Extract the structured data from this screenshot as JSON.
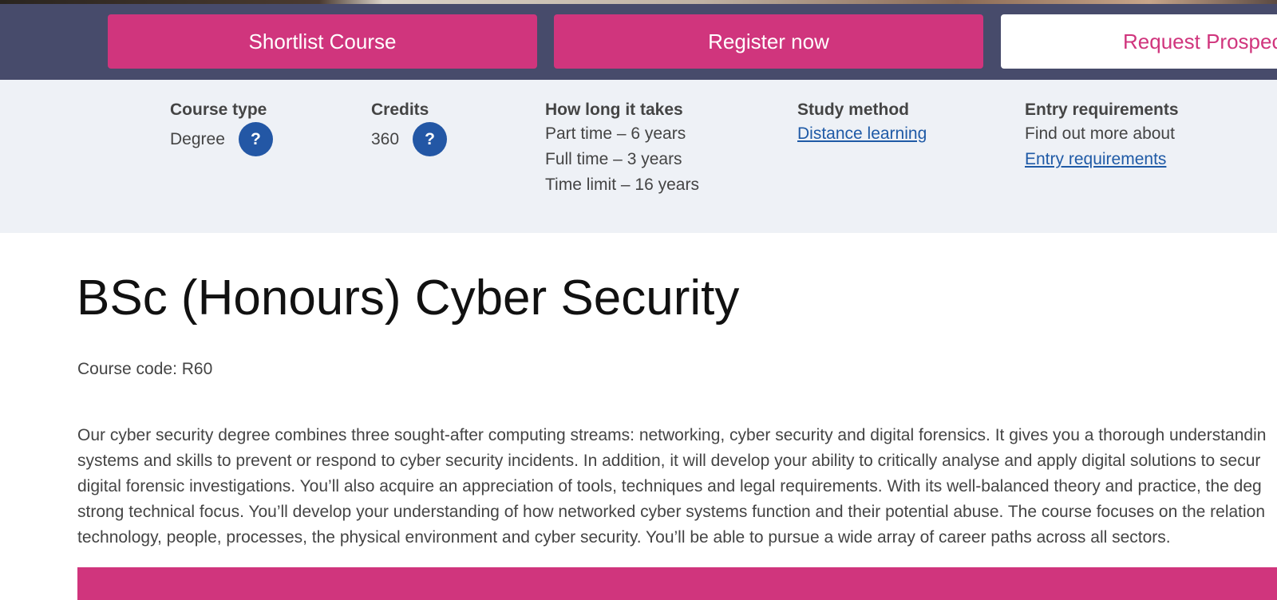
{
  "actions": {
    "shortlist_label": "Shortlist Course",
    "register_label": "Register now",
    "prospectus_label": "Request Prospec"
  },
  "info": {
    "course_type": {
      "title": "Course type",
      "value": "Degree",
      "help_icon": "?"
    },
    "credits": {
      "title": "Credits",
      "value": "360",
      "help_icon": "?"
    },
    "duration": {
      "title": "How long it takes",
      "lines": [
        "Part time – 6 years",
        "Full time – 3 years",
        "Time limit – 16 years"
      ]
    },
    "study_method": {
      "title": "Study method",
      "link": "Distance learning"
    },
    "entry": {
      "title": "Entry requirements",
      "text": "Find out more about",
      "link": "Entry requirements"
    }
  },
  "course": {
    "title": "BSc (Honours) Cyber Security",
    "code": "Course code: R60",
    "description_lines": [
      "Our cyber security degree combines three sought-after computing streams: networking, cyber security and digital forensics. It gives you a thorough understandin",
      "systems and skills to prevent or respond to cyber security incidents. In addition, it will develop your ability to critically analyse and apply digital solutions to secur",
      "digital forensic investigations. You’ll also acquire an appreciation of tools, techniques and legal requirements. With its well-balanced theory and practice, the deg",
      "strong technical focus. You’ll develop your understanding of how networked cyber systems function and their potential abuse. The course focuses on the relation",
      "technology, people, processes, the physical environment and cyber security. You’ll be able to pursue a wide array of career paths across all sectors."
    ]
  },
  "colors": {
    "accent_pink": "#d0357d",
    "header_navy": "#474b6b",
    "info_band": "#eef1f6",
    "link_blue": "#1f5aa6",
    "help_badge_blue": "#2357a5"
  }
}
